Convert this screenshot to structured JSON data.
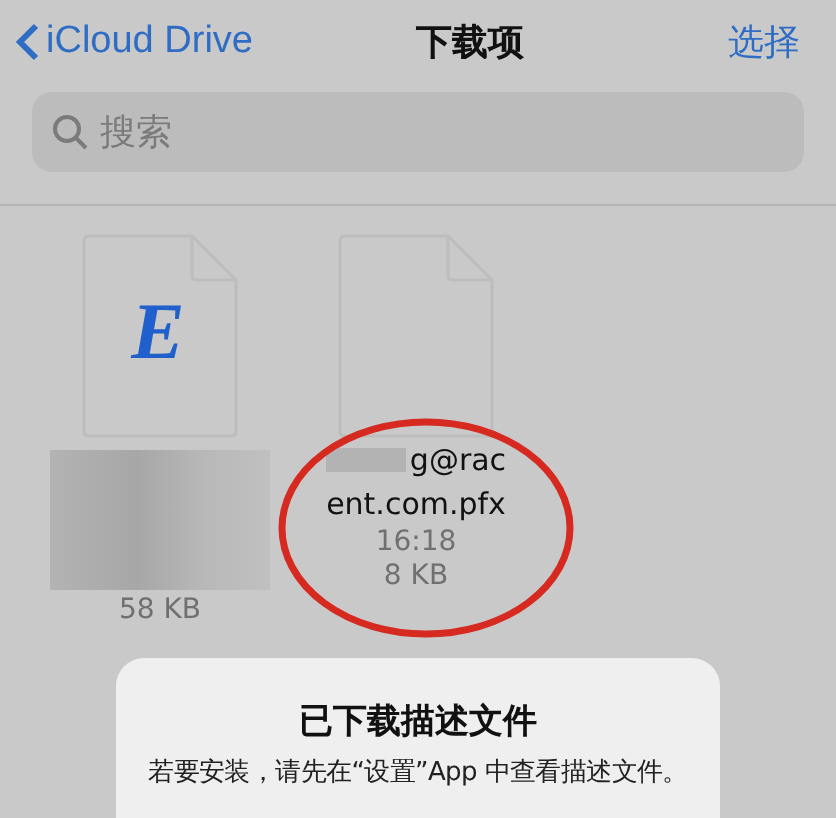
{
  "nav": {
    "back": "iCloud Drive",
    "title": "下载项",
    "action": "选择"
  },
  "search": {
    "placeholder": "搜索"
  },
  "files": [
    {
      "kind": "document",
      "letter": "E",
      "size": "58 KB",
      "blurred": true
    },
    {
      "kind": "blank",
      "name_lines": [
        "g@rac",
        "ent.com.pfx"
      ],
      "date": "16:18",
      "size": "8 KB",
      "blurred": true
    }
  ],
  "alert": {
    "title": "已下载描述文件",
    "message": "若要安装，请先在“设置”App 中查看描述文件。"
  }
}
